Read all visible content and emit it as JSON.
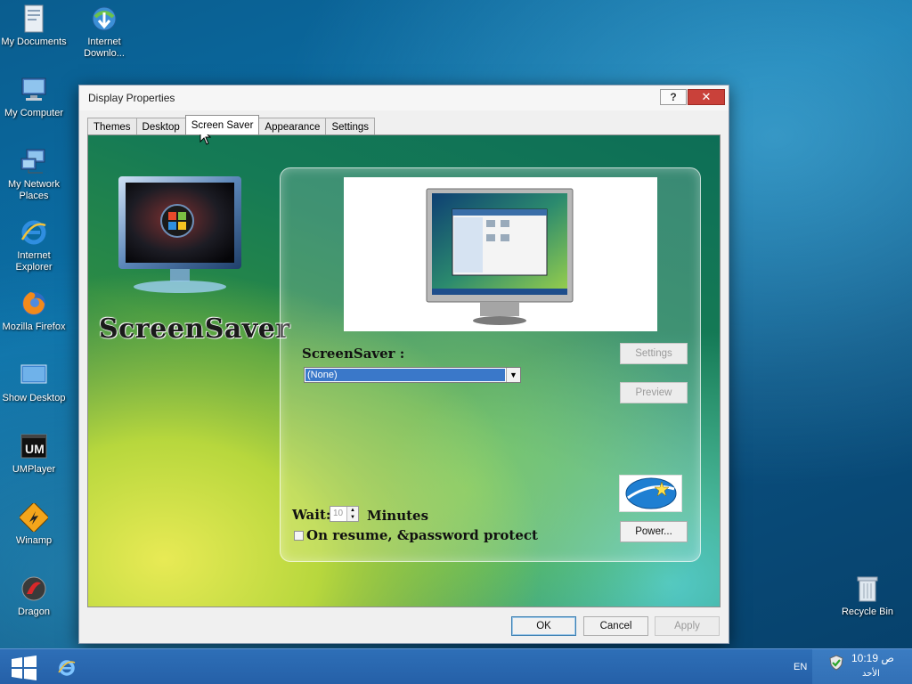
{
  "desktop": {
    "icons": [
      {
        "label": "My Documents",
        "icon": "folder-documents-icon"
      },
      {
        "label": "Internet Downlo...",
        "icon": "internet-download-manager-icon"
      },
      {
        "label": "My Computer",
        "icon": "computer-icon"
      },
      {
        "label": "My Network Places",
        "icon": "network-icon"
      },
      {
        "label": "Internet Explorer",
        "icon": "internet-explorer-icon"
      },
      {
        "label": "Mozilla Firefox",
        "icon": "firefox-icon"
      },
      {
        "label": "Show Desktop",
        "icon": "show-desktop-icon"
      },
      {
        "label": "UMPlayer",
        "icon": "umplayer-icon"
      },
      {
        "label": "Winamp",
        "icon": "winamp-icon"
      },
      {
        "label": "Dragon",
        "icon": "dragon-icon"
      },
      {
        "label": "Recycle Bin",
        "icon": "recycle-bin-icon"
      }
    ]
  },
  "window": {
    "title": "Display Properties",
    "help": "?",
    "close": "✕",
    "tabs": [
      "Themes",
      "Desktop",
      "Screen Saver",
      "Appearance",
      "Settings"
    ],
    "active_tab": "Screen Saver",
    "logo_text": "ScreenSaver",
    "screensaver_label": "ScreenSaver :",
    "screensaver_value": "(None)",
    "settings_button": "Settings",
    "preview_button": "Preview",
    "wait_label": "Wait:",
    "wait_value": "10",
    "minutes_label": "Minutes",
    "password_label": "On resume, &password protect",
    "power_button": "Power...",
    "ok_button": "OK",
    "cancel_button": "Cancel",
    "apply_button": "Apply"
  },
  "taskbar": {
    "language": "EN",
    "time": "10:19 ص",
    "day": "الأحد"
  },
  "colors": {
    "selection": "#3a78c9",
    "taskbar": "#2e6fb7",
    "close_button": "#c9413a"
  }
}
